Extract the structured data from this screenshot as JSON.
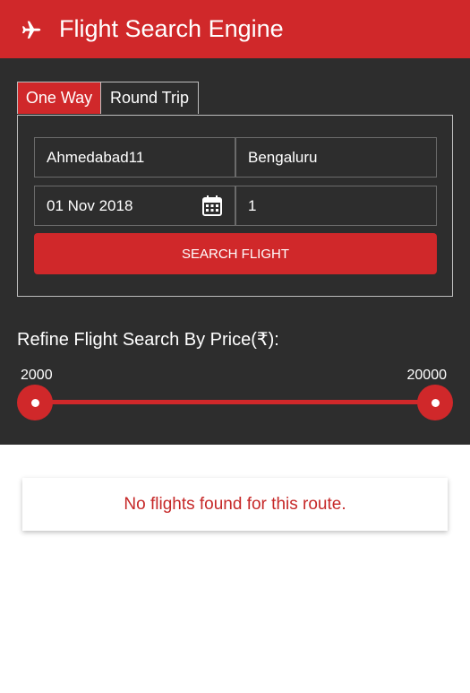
{
  "header": {
    "title": "Flight Search Engine",
    "icon": "airplane-icon",
    "color": "#d0282a"
  },
  "tabs": [
    {
      "label": "One Way",
      "active": true
    },
    {
      "label": "Round Trip",
      "active": false
    }
  ],
  "form": {
    "from": "Ahmedabad11",
    "to": "Bengaluru",
    "date": "01 Nov 2018",
    "passengers": "1",
    "search_label": "SEARCH FLIGHT"
  },
  "refine": {
    "title": "Refine Flight Search By Price(₹):",
    "min": "2000",
    "max": "20000"
  },
  "result": {
    "message": "No flights found for this route."
  }
}
